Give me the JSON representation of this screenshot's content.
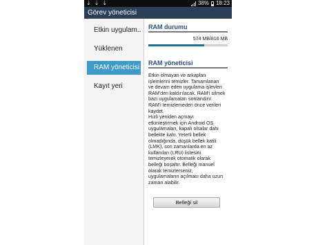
{
  "status_bar": {
    "notification_icons": [
      "download-icon",
      "download-icon",
      "download-icon"
    ],
    "battery_percent": "38%",
    "time": "18:23"
  },
  "app": {
    "title": "Görev yöneticisi"
  },
  "sidebar": {
    "items": [
      {
        "label": "Etkin uygulam..",
        "active": false
      },
      {
        "label": "Yüklenen",
        "active": false
      },
      {
        "label": "RAM yöneticisi",
        "active": true
      },
      {
        "label": "Kayıt yeri",
        "active": false
      }
    ]
  },
  "ram_status": {
    "heading": "RAM durumu",
    "usage_text": "574 MB/816 MB",
    "used_fraction": 0.7
  },
  "ram_manager": {
    "heading": "RAM yöneticisi",
    "description": "Etkin olmayan ve arkaplan\nişlemlerini temizler. Tamamlanan\nve devam eden uygulama işlevleri\nRAM'den kaldırılacak. RAM'i silmek\nbazı uygulamaları sonlandırır.\nRAM'i temizlemeden önce verileri\nkaydet.\nHızlı yeniden açmayı\netkinleştirmek için Android OS\nuygulamaları, kapalı olsalar dahi\nbellekte kalır. Yeterli bellek\nolmadığında, düşük bellek katili\n(LMK), son zamanlarda en az\nkullanılan (LRU) listesini\ntemizleyerek otomatik olarak\nbelleği boşaltır. Belleği manuel\nolarak temizlerseniz,\nuygulamaların açılması daha uzun\nzaman alabilir.",
    "clear_button_label": "Belleği sil"
  },
  "colors": {
    "title_bar": "#2b3e55",
    "active_item": "#3e9ac9",
    "section_heading": "#2a4f86",
    "progress_fill": "#1f6e8c"
  }
}
